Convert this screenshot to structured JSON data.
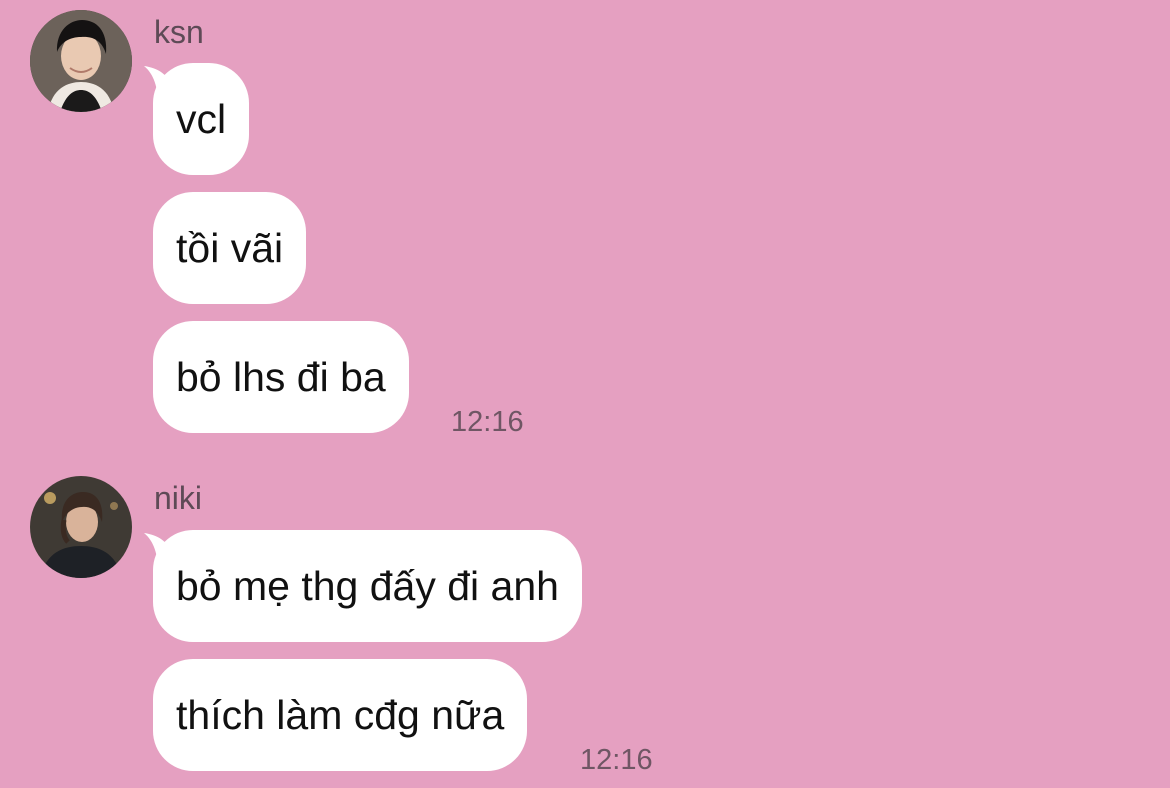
{
  "colors": {
    "background": "#E5A0C1",
    "bubble": "#FFFFFF",
    "text": "#111111",
    "meta_text": "#6F5664"
  },
  "groups": [
    {
      "sender": "ksn",
      "avatar_icon": "avatar-photo",
      "messages": [
        "vcl",
        "tồi vãi",
        "bỏ lhs đi ba"
      ],
      "time": "12:16"
    },
    {
      "sender": "niki",
      "avatar_icon": "avatar-photo",
      "messages": [
        "bỏ mẹ thg đấy đi anh",
        "thích làm cđg nữa"
      ],
      "time": "12:16"
    }
  ]
}
